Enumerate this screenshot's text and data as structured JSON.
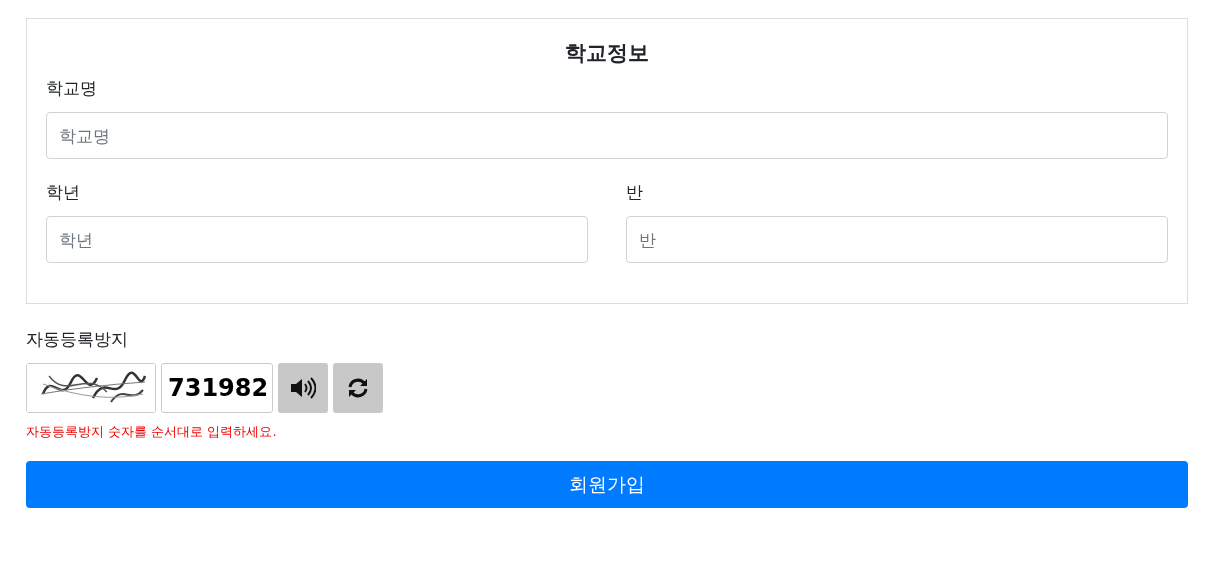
{
  "school_info": {
    "title": "학교정보",
    "fields": [
      {
        "label": "학교명",
        "placeholder": "학교명",
        "kind": "full"
      },
      {
        "label": "학년",
        "placeholder": "학년",
        "kind": "half"
      },
      {
        "label": "반",
        "placeholder": "반",
        "kind": "half"
      }
    ]
  },
  "captcha": {
    "label": "자동등록방지",
    "value": "731982",
    "hint": "자동등록방지 숫자를 순서대로 입력하세요."
  },
  "submit_button": "회원가입"
}
